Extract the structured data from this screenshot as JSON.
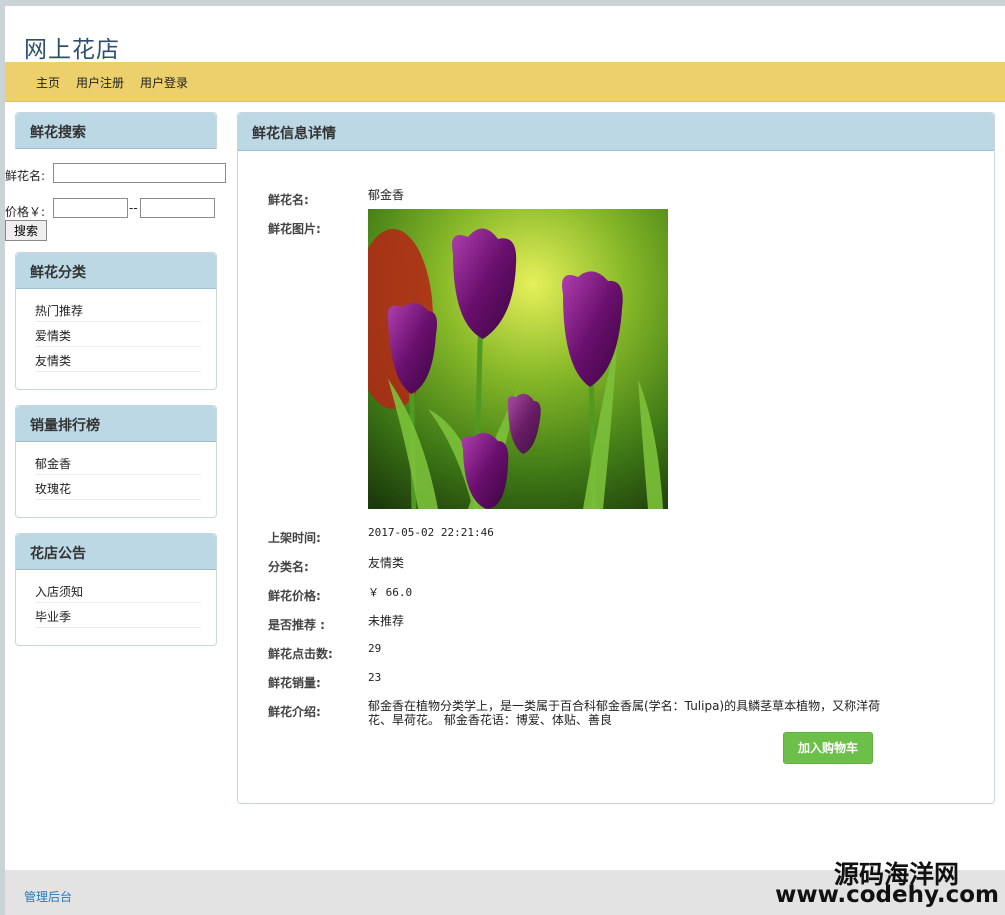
{
  "site": {
    "title": "网上花店"
  },
  "nav": {
    "items": [
      {
        "label": "主页"
      },
      {
        "label": "用户注册"
      },
      {
        "label": "用户登录"
      }
    ]
  },
  "search": {
    "title": "鲜花搜索",
    "name_label": "鲜花名:",
    "name_value": "",
    "price_label": "价格￥:",
    "price_min": "",
    "price_max": "",
    "separator": "--",
    "button": "搜索"
  },
  "categories": {
    "title": "鲜花分类",
    "items": [
      "热门推荐",
      "爱情类",
      "友情类"
    ]
  },
  "ranking": {
    "title": "销量排行榜",
    "items": [
      "郁金香",
      "玫瑰花"
    ]
  },
  "notices": {
    "title": "花店公告",
    "items": [
      "入店须知",
      "毕业季"
    ]
  },
  "detail": {
    "title": "鲜花信息详情",
    "fields": {
      "name": {
        "label": "鲜花名:",
        "value": "郁金香"
      },
      "image": {
        "label": "鲜花图片:"
      },
      "time": {
        "label": "上架时间:",
        "value": "2017-05-02 22:21:46"
      },
      "category": {
        "label": "分类名:",
        "value": "友情类"
      },
      "price": {
        "label": "鲜花价格:",
        "value": "￥ 66.0"
      },
      "recommend": {
        "label": "是否推荐 :",
        "value": "未推荐"
      },
      "clicks": {
        "label": "鲜花点击数:",
        "value": "29"
      },
      "sales": {
        "label": "鲜花销量:",
        "value": "23"
      },
      "intro": {
        "label": "鲜花介绍:",
        "value": "郁金香在植物分类学上，是一类属于百合科郁金香属(学名：Tulipa)的具鳞茎草本植物，又称洋荷花、旱荷花。 郁金香花语：博爱、体贴、善良"
      }
    },
    "add_cart": "加入购物车"
  },
  "footer": {
    "admin_link": "管理后台"
  },
  "watermark": {
    "line1": "源码海洋网",
    "line2": "www.codehy.com"
  }
}
